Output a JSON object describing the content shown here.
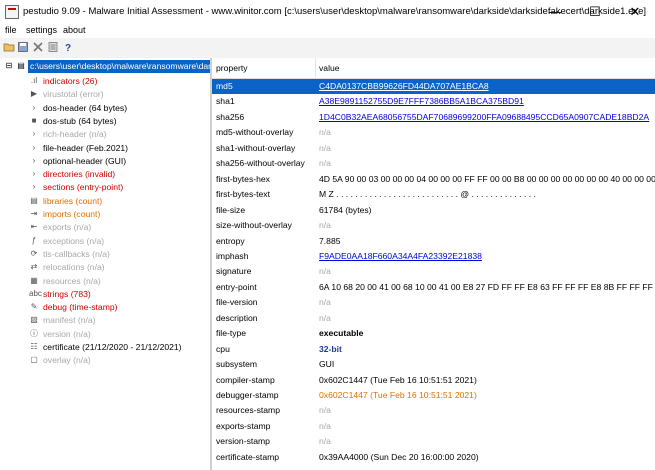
{
  "window": {
    "title": "pestudio 9.09 - Malware Initial Assessment - www.winitor.com [c:\\users\\user\\desktop\\malware\\ransomware\\darkside\\darksidefakecert\\darkside1.exe]",
    "minimize_glyph": "—",
    "maximize_glyph": "☐",
    "close_glyph": "✕"
  },
  "menu": {
    "file": "file",
    "settings": "settings",
    "about": "about"
  },
  "toolbar": {
    "icons": [
      "folder-open-icon",
      "save-icon",
      "delete-icon",
      "list-icon",
      "help-icon"
    ]
  },
  "tree": {
    "root": "c:\\users\\user\\desktop\\malware\\ransomware\\dar",
    "items": [
      {
        "label": "indicators (26)",
        "color": "red",
        "icon": "indicators-icon",
        "glyph": ".ıl"
      },
      {
        "label": "virustotal (error)",
        "color": "gray",
        "icon": "virustotal-icon",
        "glyph": "▶"
      },
      {
        "label": "dos-header (64 bytes)",
        "color": "black",
        "icon": "chevron-right-icon",
        "glyph": "›"
      },
      {
        "label": "dos-stub (64 bytes)",
        "color": "black",
        "icon": "console-icon",
        "glyph": "■"
      },
      {
        "label": "rich-header (n/a)",
        "color": "gray",
        "icon": "chevron-right-icon",
        "glyph": "›"
      },
      {
        "label": "file-header (Feb.2021)",
        "color": "black",
        "icon": "chevron-right-icon",
        "glyph": "›"
      },
      {
        "label": "optional-header (GUI)",
        "color": "black",
        "icon": "chevron-right-icon",
        "glyph": "›"
      },
      {
        "label": "directories (invalid)",
        "color": "red",
        "icon": "chevron-right-icon",
        "glyph": "›"
      },
      {
        "label": "sections (entry-point)",
        "color": "red",
        "icon": "chevron-right-icon",
        "glyph": "›"
      },
      {
        "label": "libraries (count)",
        "color": "orange",
        "icon": "libraries-icon",
        "glyph": "▤"
      },
      {
        "label": "imports (count)",
        "color": "orange",
        "icon": "imports-icon",
        "glyph": "⇥"
      },
      {
        "label": "exports (n/a)",
        "color": "gray",
        "icon": "exports-icon",
        "glyph": "⇤"
      },
      {
        "label": "exceptions (n/a)",
        "color": "gray",
        "icon": "exceptions-icon",
        "glyph": "ƒ"
      },
      {
        "label": "tls-callbacks (n/a)",
        "color": "gray",
        "icon": "tls-callbacks-icon",
        "glyph": "⟳"
      },
      {
        "label": "relocations (n/a)",
        "color": "gray",
        "icon": "relocations-icon",
        "glyph": "⇄"
      },
      {
        "label": "resources (n/a)",
        "color": "gray",
        "icon": "resources-icon",
        "glyph": "▦"
      },
      {
        "label": "strings (783)",
        "color": "red",
        "icon": "strings-icon",
        "glyph": "abc"
      },
      {
        "label": "debug (time-stamp)",
        "color": "red",
        "icon": "debug-icon",
        "glyph": "✎"
      },
      {
        "label": "manifest (n/a)",
        "color": "gray",
        "icon": "manifest-icon",
        "glyph": "▧"
      },
      {
        "label": "version (n/a)",
        "color": "gray",
        "icon": "version-icon",
        "glyph": "ⓘ"
      },
      {
        "label": "certificate (21/12/2020 - 21/12/2021)",
        "color": "black",
        "icon": "certificate-icon",
        "glyph": "☷"
      },
      {
        "label": "overlay (n/a)",
        "color": "gray",
        "icon": "overlay-icon",
        "glyph": "▢"
      }
    ]
  },
  "table": {
    "col_property": "property",
    "col_value": "value",
    "rows": [
      {
        "property": "md5",
        "value": "C4DA0137CBB99626FD44DA707AE1BCA8",
        "style": "sel-link",
        "selected": true
      },
      {
        "property": "sha1",
        "value": "A38E9891152755D9E7FFF7386BB5A1BCA375BD91",
        "style": "blue-link"
      },
      {
        "property": "sha256",
        "value": "1D4C0B32AEA68056755DAF70689699200FFA09688495CCD65A0907CADE18BD2A",
        "style": "blue-link"
      },
      {
        "property": "md5-without-overlay",
        "value": "n/a",
        "style": "gray"
      },
      {
        "property": "sha1-without-overlay",
        "value": "n/a",
        "style": "gray"
      },
      {
        "property": "sha256-without-overlay",
        "value": "n/a",
        "style": "gray"
      },
      {
        "property": "first-bytes-hex",
        "value": "4D 5A 90 00 03 00 00 00 04 00 00 00 FF FF 00 00 B8 00 00 00 00 00 00 00 40 00 00 00 00 00 00 00",
        "style": ""
      },
      {
        "property": "first-bytes-text",
        "value": "M Z . . . . . . . . . . . . . . . . . . . . . . . . . . @ . . . . . . . . . . . . . .",
        "style": ""
      },
      {
        "property": "file-size",
        "value": "61784 (bytes)",
        "style": ""
      },
      {
        "property": "size-without-overlay",
        "value": "n/a",
        "style": "gray"
      },
      {
        "property": "entropy",
        "value": "7.885",
        "style": ""
      },
      {
        "property": "imphash",
        "value": "F9ADE0AA18F660A34A4FA23392E21838",
        "style": "blue-link"
      },
      {
        "property": "signature",
        "value": "n/a",
        "style": "gray"
      },
      {
        "property": "entry-point",
        "value": "6A 10 68 20 00 41 00 68 10 00 41 00 E8 27 FD FF FF E8 63 FF FF FF E8 8B FF FF FF E8 AF FF FF FF",
        "style": ""
      },
      {
        "property": "file-version",
        "value": "n/a",
        "style": "gray"
      },
      {
        "property": "description",
        "value": "n/a",
        "style": "gray"
      },
      {
        "property": "file-type",
        "value": "executable",
        "style": "bold"
      },
      {
        "property": "cpu",
        "value": "32-bit",
        "style": "bold-blue"
      },
      {
        "property": "subsystem",
        "value": "GUI",
        "style": ""
      },
      {
        "property": "compiler-stamp",
        "value": "0x602C1447 (Tue Feb 16 10:51:51 2021)",
        "style": ""
      },
      {
        "property": "debugger-stamp",
        "value": "0x602C1447 (Tue Feb 16 10:51:51 2021)",
        "style": "orange-text"
      },
      {
        "property": "resources-stamp",
        "value": "n/a",
        "style": "gray"
      },
      {
        "property": "exports-stamp",
        "value": "n/a",
        "style": "gray"
      },
      {
        "property": "version-stamp",
        "value": "n/a",
        "style": "gray"
      },
      {
        "property": "certificate-stamp",
        "value": "0x39AA4000 (Sun Dec 20 16:00:00 2020)",
        "style": ""
      }
    ]
  }
}
